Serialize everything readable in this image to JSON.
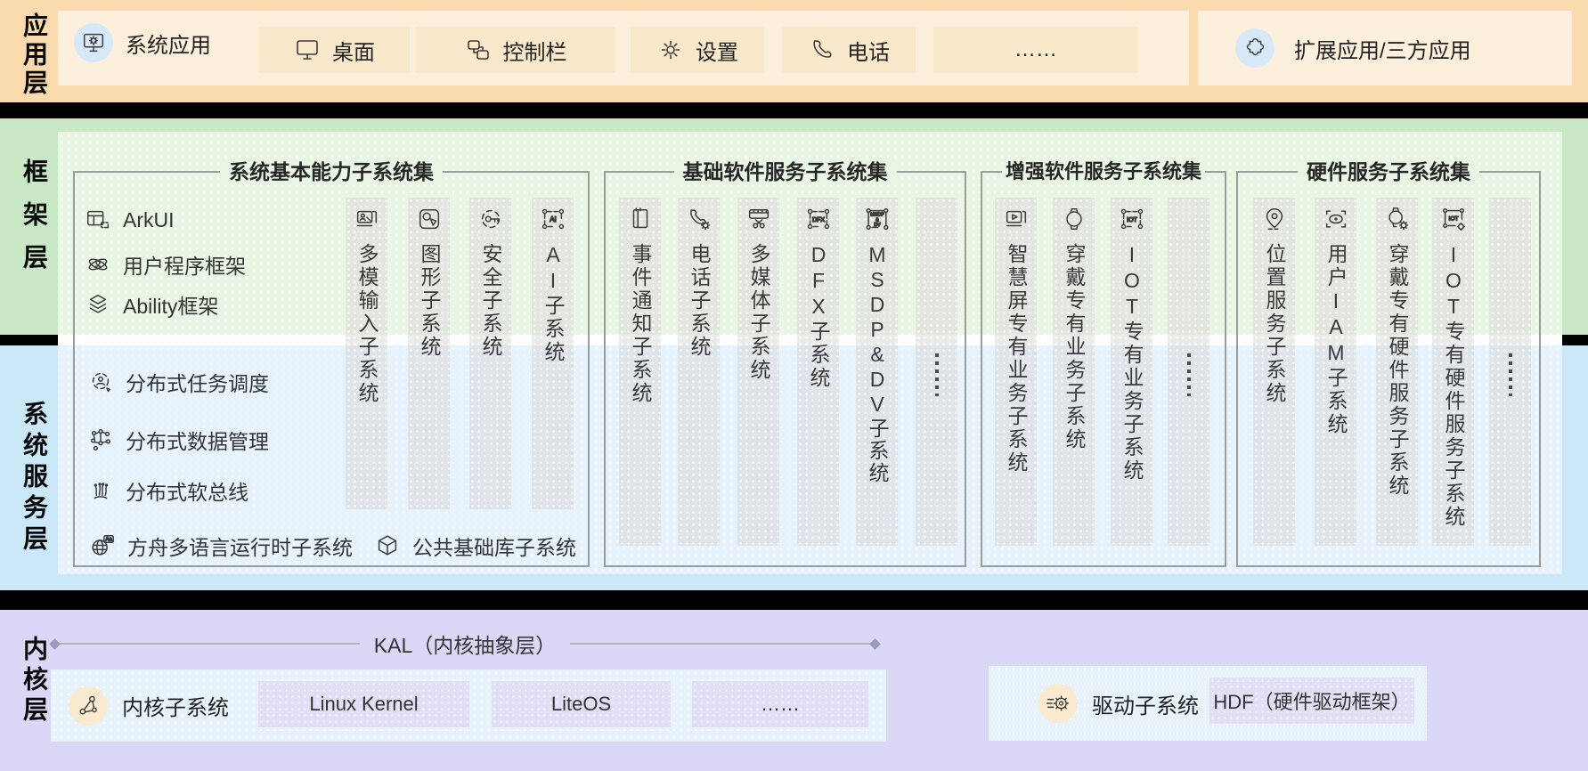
{
  "layer_labels": {
    "app": "应用层",
    "framework": "框架层",
    "service": "系统服务层",
    "kernel": "内核层"
  },
  "app_layer": {
    "items": [
      {
        "label": "系统应用",
        "icon": "system-app"
      },
      {
        "label": "桌面",
        "icon": "desktop"
      },
      {
        "label": "控制栏",
        "icon": "control-bar"
      },
      {
        "label": "设置",
        "icon": "settings-gear"
      },
      {
        "label": "电话",
        "icon": "phone"
      },
      {
        "label": "……",
        "icon": "none"
      }
    ],
    "extension_label": "扩展应用/三方应用"
  },
  "groups": [
    {
      "title": "系统基本能力子系统集",
      "framework_items": [
        "ArkUI",
        "用户程序框架",
        "Ability框架"
      ],
      "service_items": [
        "分布式任务调度",
        "分布式数据管理",
        "分布式软总线"
      ],
      "bottom_items": [
        "方舟多语言运行时子系统",
        "公共基础库子系统"
      ],
      "columns": [
        "多模输入子系统",
        "图形子系统",
        "安全子系统",
        "AI子系统"
      ]
    },
    {
      "title": "基础软件服务子系统集",
      "columns": [
        "事件通知子系统",
        "电话子系统",
        "多媒体子系统",
        "DFX子系统",
        "MSDP&DV子系统"
      ],
      "ellipsis": "⋮"
    },
    {
      "title": "增强软件服务子系统集",
      "columns": [
        "智慧屏专有业务子系统",
        "穿戴专有业务子系统",
        "IOT专有业务子系统"
      ],
      "ellipsis": "⋮"
    },
    {
      "title": "硬件服务子系统集",
      "columns": [
        "位置服务子系统",
        "用户IAM子系统",
        "穿戴专有硬件服务子系统",
        "IOT专有硬件服务子系统"
      ],
      "ellipsis": "⋮"
    }
  ],
  "kernel_layer": {
    "kal_label": "KAL（内核抽象层）",
    "kernel_subsystem": "内核子系统",
    "kernel_boxes": [
      "Linux Kernel",
      "LiteOS",
      "……"
    ],
    "driver_subsystem": "驱动子系统",
    "driver_boxes": [
      "HDF（硬件驱动框架）"
    ]
  },
  "icon_texts": {
    "ai": "AI",
    "dfx": "DFX",
    "iot": "IOT",
    "msdp1": "MSDP",
    "msdp2": "&",
    "msdp3": "DV",
    "aa": "Aa"
  },
  "colors": {
    "app_band": "#F8DAAC",
    "framework_band": "#C9E9C6",
    "service_band": "#CBE8F8",
    "kernel_band": "#DAD8F6",
    "separator": "#000000",
    "panel_cream": "#FCF0DC",
    "panel_green": "#E9F6E4",
    "panel_blue": "#E6F3FD",
    "column_gray": "#E2E6DF",
    "box_border": "#9C9C9C",
    "icon_circle_blue": "#D7E9F9",
    "icon_circle_cream": "#FAEBD0",
    "kernel_box_lavender": "#E1DEF6"
  }
}
